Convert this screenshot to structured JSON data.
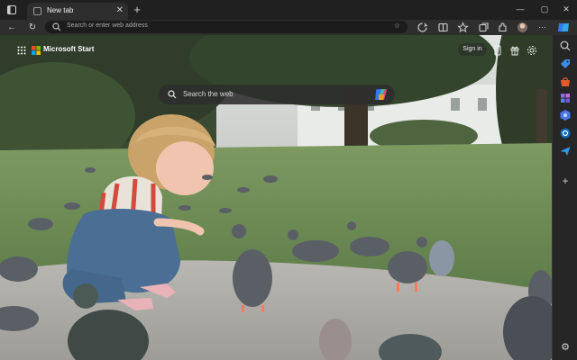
{
  "browser": {
    "tab_title": "New tab",
    "tab_close_glyph": "✕",
    "new_tab_glyph": "+",
    "window_controls": {
      "minimize": "—",
      "maximize": "▢",
      "close": "✕"
    },
    "nav": {
      "back": "←",
      "refresh": "↻"
    },
    "address_placeholder": "Search or enter web address",
    "favorite_glyph": "☆",
    "toolbar_icons": [
      "browser-essentials-icon",
      "split-screen-icon",
      "favorites-icon",
      "collections-icon",
      "extensions-icon",
      "profile-icon",
      "more-icon"
    ],
    "more_glyph": "···"
  },
  "page": {
    "brand": "Microsoft Start",
    "signin": "Sign in",
    "search_placeholder": "Search the web",
    "colors": {
      "accent": "#0078d4",
      "copilot": [
        "#2f7bf5",
        "#f5a623",
        "#e9467a",
        "#36c5a5"
      ]
    }
  },
  "sidebar": {
    "items": [
      {
        "name": "search-icon",
        "color": "#3a3a3a"
      },
      {
        "name": "tag-icon",
        "color": "#3a8ee6"
      },
      {
        "name": "shopping-icon",
        "color": "#e05c2a"
      },
      {
        "name": "tools-icon",
        "color": "#6b5ad6"
      },
      {
        "name": "games-icon",
        "color": "#4a77e8"
      },
      {
        "name": "outlook-icon",
        "color": "#0f6cbd"
      },
      {
        "name": "send-icon",
        "color": "#2f98e8"
      }
    ],
    "add_glyph": "+",
    "settings_glyph": "⚙"
  }
}
